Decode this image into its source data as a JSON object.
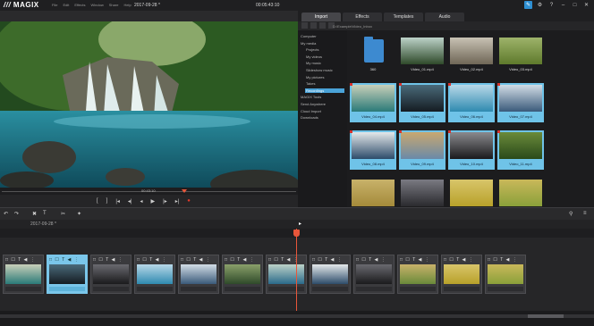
{
  "app": {
    "logo": "MAGIX",
    "menu": [
      "File",
      "Edit",
      "Effects",
      "Window",
      "Share",
      "Help"
    ],
    "date": "2017-09-28 *",
    "timecode": "00:05:43:10"
  },
  "tabs": [
    {
      "label": "Import",
      "active": true
    },
    {
      "label": "Effects",
      "active": false
    },
    {
      "label": "Templates",
      "active": false
    },
    {
      "label": "Audio",
      "active": false
    }
  ],
  "media_pool": {
    "path": "D:\\Example\\Video_Inbox",
    "sidebar": [
      {
        "label": "Computer",
        "level": 0,
        "selected": false
      },
      {
        "label": "My media",
        "level": 0,
        "selected": false
      },
      {
        "label": "Projects",
        "level": 1,
        "selected": false
      },
      {
        "label": "My videos",
        "level": 1,
        "selected": false
      },
      {
        "label": "My music",
        "level": 1,
        "selected": false
      },
      {
        "label": "Slideshow music",
        "level": 1,
        "selected": false
      },
      {
        "label": "My pictures",
        "level": 1,
        "selected": false
      },
      {
        "label": "Takes",
        "level": 1,
        "selected": false
      },
      {
        "label": "Recordings",
        "level": 1,
        "selected": true
      },
      {
        "label": "MAGIX Tools",
        "level": 0,
        "selected": false
      },
      {
        "label": "Send Anywhere",
        "level": 0,
        "selected": false
      },
      {
        "label": "Cloud Import",
        "level": 0,
        "selected": false
      },
      {
        "label": "Downloads",
        "level": 0,
        "selected": false
      }
    ],
    "items": [
      {
        "label": "360",
        "kind": "folder",
        "selected": false,
        "palette": [
          "#3d8ad0",
          "#3d8ad0"
        ]
      },
      {
        "label": "Video_01.mp4",
        "kind": "video",
        "selected": false,
        "palette": [
          "#2f4a2a",
          "#bcd2c8"
        ]
      },
      {
        "label": "Video_02.mp4",
        "kind": "video",
        "selected": false,
        "palette": [
          "#6f6656",
          "#c8c2b4"
        ]
      },
      {
        "label": "Video_03.mp4",
        "kind": "video",
        "selected": false,
        "palette": [
          "#5f7a2c",
          "#9db36a"
        ]
      },
      {
        "label": "Video_04.mp4",
        "kind": "video",
        "selected": true,
        "palette": [
          "#2a7a78",
          "#c8cfb9"
        ]
      },
      {
        "label": "Video_05.mp4",
        "kind": "video",
        "selected": true,
        "palette": [
          "#151c22",
          "#4a6a7a"
        ]
      },
      {
        "label": "Video_06.mp4",
        "kind": "video",
        "selected": true,
        "palette": [
          "#2f8ab0",
          "#b8d8e8"
        ]
      },
      {
        "label": "Video_07.mp4",
        "kind": "video",
        "selected": true,
        "palette": [
          "#3a5a7a",
          "#d2dde6"
        ]
      },
      {
        "label": "Video_08.mp4",
        "kind": "video",
        "selected": true,
        "palette": [
          "#2d4c6a",
          "#e4e8ea"
        ]
      },
      {
        "label": "Video_09.mp4",
        "kind": "video",
        "selected": true,
        "palette": [
          "#6a8aa8",
          "#c8a870"
        ]
      },
      {
        "label": "Video_10.mp4",
        "kind": "video",
        "selected": true,
        "palette": [
          "#1a1a1c",
          "#8a8a8e"
        ]
      },
      {
        "label": "Video_11.mp4",
        "kind": "video",
        "selected": true,
        "palette": [
          "#2a4a1a",
          "#6a8a3a"
        ]
      },
      {
        "label": "",
        "kind": "video",
        "selected": false,
        "palette": [
          "#a48a3a",
          "#c8b26a"
        ]
      },
      {
        "label": "",
        "kind": "video",
        "selected": false,
        "palette": [
          "#2a2a2e",
          "#7a7a82"
        ]
      },
      {
        "label": "",
        "kind": "video",
        "selected": false,
        "palette": [
          "#b8a12a",
          "#d8c56a"
        ]
      },
      {
        "label": "",
        "kind": "video",
        "selected": false,
        "palette": [
          "#8aa03a",
          "#c9b85a"
        ]
      }
    ]
  },
  "timeline": {
    "date": "2017-09-28 *",
    "clips": [
      {
        "selected": false,
        "palette": [
          "#2a7a78",
          "#c8cfb9"
        ]
      },
      {
        "selected": true,
        "palette": [
          "#151c22",
          "#4a6a7a"
        ]
      },
      {
        "selected": false,
        "palette": [
          "#1a1a1c",
          "#6a6a70"
        ]
      },
      {
        "selected": false,
        "palette": [
          "#2f8ab0",
          "#b8d8e8"
        ]
      },
      {
        "selected": false,
        "palette": [
          "#3a5a7a",
          "#d2dde6"
        ]
      },
      {
        "selected": false,
        "palette": [
          "#2f4a2a",
          "#8aa06a"
        ]
      },
      {
        "selected": false,
        "palette": [
          "#2a6a8a",
          "#bcd2c8"
        ]
      },
      {
        "selected": false,
        "palette": [
          "#2d4c6a",
          "#e4e8ea"
        ]
      },
      {
        "selected": false,
        "palette": [
          "#1a1a1c",
          "#6a6a70"
        ]
      },
      {
        "selected": false,
        "palette": [
          "#6a8a3a",
          "#c8b26a"
        ]
      },
      {
        "selected": false,
        "palette": [
          "#b8a12a",
          "#d8c56a"
        ]
      },
      {
        "selected": false,
        "palette": [
          "#8aa03a",
          "#c9b85a"
        ]
      }
    ]
  },
  "preview": {
    "scrub_timecode": "00:43:10"
  },
  "colors": {
    "accent": "#2e8fd2",
    "playhead": "#e8563a",
    "selection": "#6fc3e8"
  }
}
